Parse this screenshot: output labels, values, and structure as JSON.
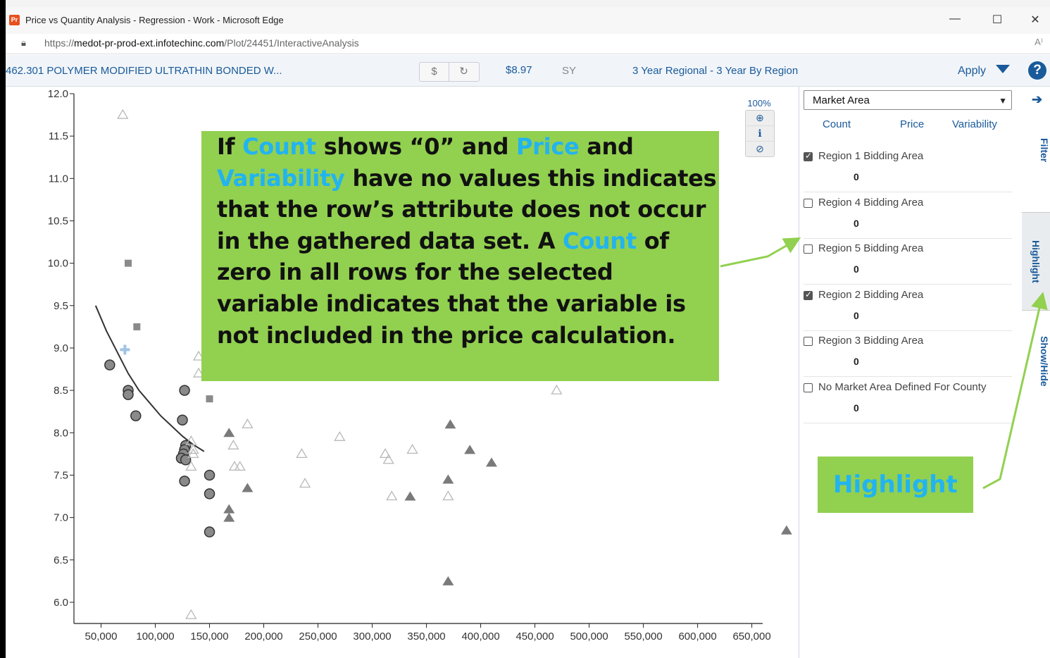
{
  "browser": {
    "app_icon_label": "Pr",
    "title": "Price vs Quantity Analysis - Regression - Work - Microsoft Edge",
    "url_prefix": "https://",
    "url_domain": "medot-pr-prod-ext.infotechinc.com",
    "url_path": "/Plot/24451/InteractiveAnalysis",
    "minimize": "—",
    "maximize": "☐",
    "close": "✕",
    "read_aloud": "A⁾"
  },
  "toolbar": {
    "item_name": "462.301 POLYMER MODIFIED ULTRATHIN BONDED W...",
    "dollar_btn": "$",
    "refresh_btn": "↻",
    "price": "$8.97",
    "unit": "SY",
    "regional": "3 Year Regional - 3 Year By Region",
    "apply": "Apply",
    "help": "?"
  },
  "zoom": {
    "level": "100%",
    "zoom_in": "⊕",
    "info": "ℹ",
    "reset": "⊘"
  },
  "callout": {
    "parts": [
      {
        "t": "If ",
        "h": false
      },
      {
        "t": "Count",
        "h": true
      },
      {
        "t": " shows “0” and ",
        "h": false
      },
      {
        "t": "Price",
        "h": true
      },
      {
        "t": " and ",
        "h": false
      },
      {
        "t": "Variability",
        "h": true
      },
      {
        "t": " have no values this indicates that the row’s attribute does not occur in the gathered data set.  A ",
        "h": false
      },
      {
        "t": "Count",
        "h": true
      },
      {
        "t": " of zero in all rows for the selected variable indicates that the variable is not included in the price calculation.",
        "h": false
      }
    ]
  },
  "panel": {
    "dropdown_value": "Market Area",
    "headers": [
      "Count",
      "Price",
      "Variability"
    ],
    "rows": [
      {
        "label": "Region 1 Bidding Area",
        "checked": true,
        "count": "0"
      },
      {
        "label": "Region 4 Bidding Area",
        "checked": false,
        "count": "0"
      },
      {
        "label": "Region 5 Bidding Area",
        "checked": false,
        "count": "0"
      },
      {
        "label": "Region 2 Bidding Area",
        "checked": true,
        "count": "0"
      },
      {
        "label": "Region 3 Bidding Area",
        "checked": false,
        "count": "0"
      },
      {
        "label": "No Market Area Defined For County",
        "checked": false,
        "count": "0"
      }
    ]
  },
  "highlight_callout": "Highlight",
  "side_tabs": {
    "arrow": "➔",
    "filter": "Filter",
    "highlight": "Highlight",
    "show_hide": "Show/Hide"
  },
  "colors": {
    "accent": "#1a5a9a",
    "callout_green": "#92d050",
    "callout_blue": "#22b4f0"
  },
  "chart_data": {
    "type": "scatter",
    "xlim": [
      25000,
      660000
    ],
    "ylim": [
      5.75,
      12.0
    ],
    "x_ticks": [
      50000,
      100000,
      150000,
      200000,
      250000,
      300000,
      350000,
      400000,
      450000,
      500000,
      550000,
      600000,
      650000
    ],
    "x_tick_labels": [
      "50,000",
      "100,000",
      "150,000",
      "200,000",
      "250,000",
      "300,000",
      "350,000",
      "400,000",
      "450,000",
      "500,000",
      "550,000",
      "600,000",
      "650,000"
    ],
    "y_ticks": [
      6.0,
      6.5,
      7.0,
      7.5,
      8.0,
      8.5,
      9.0,
      9.5,
      10.0,
      10.5,
      11.0,
      11.5,
      12.0
    ],
    "y_tick_labels": [
      "6.0",
      "6.5",
      "7.0",
      "7.5",
      "8.0",
      "8.5",
      "9.0",
      "9.5",
      "10.0",
      "10.5",
      "11.0",
      "11.5",
      "12.0"
    ],
    "series": [
      {
        "marker": "circle",
        "points": [
          [
            58000,
            8.8
          ],
          [
            75000,
            8.5
          ],
          [
            75000,
            8.45
          ],
          [
            82000,
            8.2
          ],
          [
            127000,
            8.5
          ],
          [
            125000,
            8.15
          ],
          [
            128000,
            7.85
          ],
          [
            127000,
            7.8
          ],
          [
            126000,
            7.75
          ],
          [
            124000,
            7.7
          ],
          [
            128000,
            7.68
          ],
          [
            127000,
            7.43
          ],
          [
            150000,
            7.5
          ],
          [
            150000,
            7.28
          ],
          [
            150000,
            6.83
          ]
        ]
      },
      {
        "marker": "square",
        "points": [
          [
            75000,
            10.0
          ],
          [
            83000,
            9.25
          ],
          [
            150000,
            8.4
          ]
        ]
      },
      {
        "marker": "plus",
        "points": [
          [
            72000,
            8.98
          ]
        ]
      },
      {
        "marker": "triangle-open",
        "points": [
          [
            70000,
            11.75
          ],
          [
            140000,
            8.9
          ],
          [
            140000,
            8.7
          ],
          [
            185000,
            8.1
          ],
          [
            133000,
            7.9
          ],
          [
            135000,
            7.8
          ],
          [
            135000,
            7.75
          ],
          [
            133000,
            7.6
          ],
          [
            172000,
            7.85
          ],
          [
            173000,
            7.6
          ],
          [
            178000,
            7.6
          ],
          [
            235000,
            7.75
          ],
          [
            238000,
            7.4
          ],
          [
            270000,
            7.95
          ],
          [
            312000,
            7.75
          ],
          [
            315000,
            7.68
          ],
          [
            337000,
            7.8
          ],
          [
            318000,
            7.25
          ],
          [
            370000,
            7.25
          ],
          [
            133000,
            5.85
          ],
          [
            470000,
            8.5
          ]
        ]
      },
      {
        "marker": "triangle-filled",
        "points": [
          [
            168000,
            8.0
          ],
          [
            185000,
            7.35
          ],
          [
            168000,
            7.1
          ],
          [
            168000,
            7.0
          ],
          [
            372000,
            8.1
          ],
          [
            390000,
            7.8
          ],
          [
            410000,
            7.65
          ],
          [
            370000,
            7.45
          ],
          [
            335000,
            7.25
          ],
          [
            370000,
            6.25
          ],
          [
            682000,
            6.85
          ]
        ]
      }
    ],
    "trendline": [
      [
        45000,
        9.5
      ],
      [
        55000,
        9.2
      ],
      [
        65000,
        8.95
      ],
      [
        75000,
        8.7
      ],
      [
        85000,
        8.5
      ],
      [
        95000,
        8.35
      ],
      [
        105000,
        8.2
      ],
      [
        115000,
        8.08
      ],
      [
        125000,
        7.96
      ],
      [
        135000,
        7.86
      ],
      [
        145000,
        7.78
      ]
    ]
  }
}
